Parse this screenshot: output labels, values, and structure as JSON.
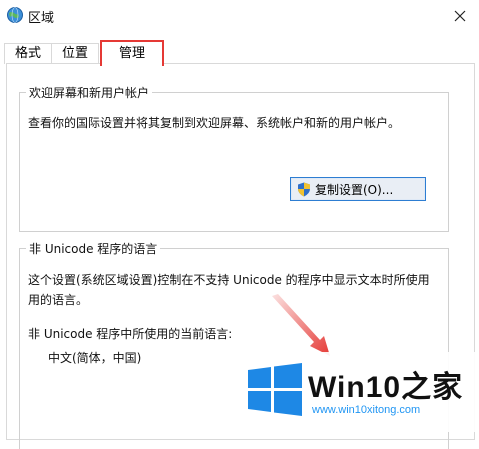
{
  "window": {
    "title": "区域",
    "icons": {
      "app": "globe-icon",
      "close": "close-icon"
    }
  },
  "tabs": [
    {
      "label": "格式",
      "selected": false
    },
    {
      "label": "位置",
      "selected": false
    },
    {
      "label": "管理",
      "selected": true
    }
  ],
  "welcome_group": {
    "legend": "欢迎屏幕和新用户帐户",
    "description": "查看你的国际设置并将其复制到欢迎屏幕、系统帐户和新的用户帐户。",
    "copy_button": "复制设置(O)...",
    "copy_button_icon": "uac-shield-icon"
  },
  "non_unicode_group": {
    "legend": "非 Unicode 程序的语言",
    "line1": "这个设置(系统区域设置)控制在不支持 Unicode 的程序中显示文本时所使用",
    "line2": "用的语言。",
    "current_label": "非 Unicode 程序中所使用的当前语言:",
    "current_value": "中文(简体，中国)"
  },
  "watermark": {
    "brand_prefix": "Win10",
    "brand_suffix": "之家",
    "url": "www.win10xitong.com",
    "logo": "windows-logo-icon"
  },
  "colors": {
    "highlight_border": "#e53935",
    "button_border": "#2d7dd2",
    "watermark_blue": "#1e88e5"
  }
}
